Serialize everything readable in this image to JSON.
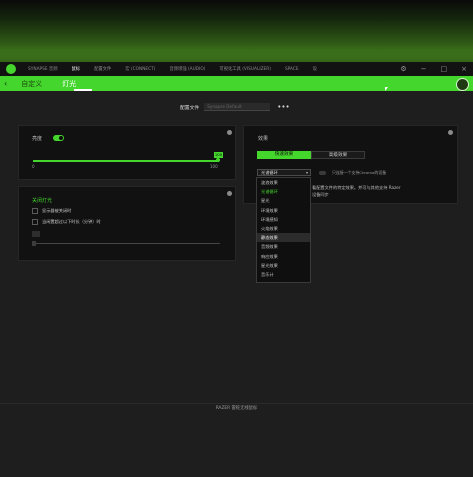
{
  "app_tabs": [
    "SYNAPSE 音频",
    "鼠标",
    "配置文件",
    "宏 (CONNECT)",
    "音频增强 (AUDIO)",
    "可视化工具 (VISUALIZER)",
    "SPACE",
    "设"
  ],
  "window_controls": [
    "⚙",
    "−",
    "□",
    "×"
  ],
  "nav": {
    "back": "‹",
    "tabs": [
      "自定义",
      "灯光"
    ]
  },
  "profile": {
    "label": "配置文件",
    "value": "Synapse Default",
    "more": "•••"
  },
  "brightness_panel": {
    "title": "亮度",
    "min_label": "0",
    "max_label": "100",
    "value_label": "100"
  },
  "switch_off_panel": {
    "title": "关闭灯光",
    "option1": "显示器被关闭时",
    "option2": "当闲置超过以下时长（分钟）时"
  },
  "effects_panel": {
    "title": "效果",
    "tab_quick": "快速效果",
    "tab_advanced": "高级效果",
    "selected_effect": "光谱循环",
    "chroma_text": "只连接一个支持Chroma的设备",
    "desc_line1": "看配置文件的特定效果。并可与其他支持 Razer",
    "desc_line2": "设备同步",
    "dropdown_items": [
      "波浪效果",
      "光谱循环",
      "星光",
      "环境效果",
      "环境感知",
      "火焰效果",
      "静态效果",
      "音频效果",
      "响应效果",
      "星光效果",
      "音乐计"
    ],
    "selected_index": 1,
    "hover_index": 6
  },
  "footer": {
    "text": "RAZER 雷蛇无线鼠标"
  },
  "colors": {
    "accent": "#44d62c",
    "panel_bg": "#111111",
    "page_bg": "#1e1e1e"
  }
}
